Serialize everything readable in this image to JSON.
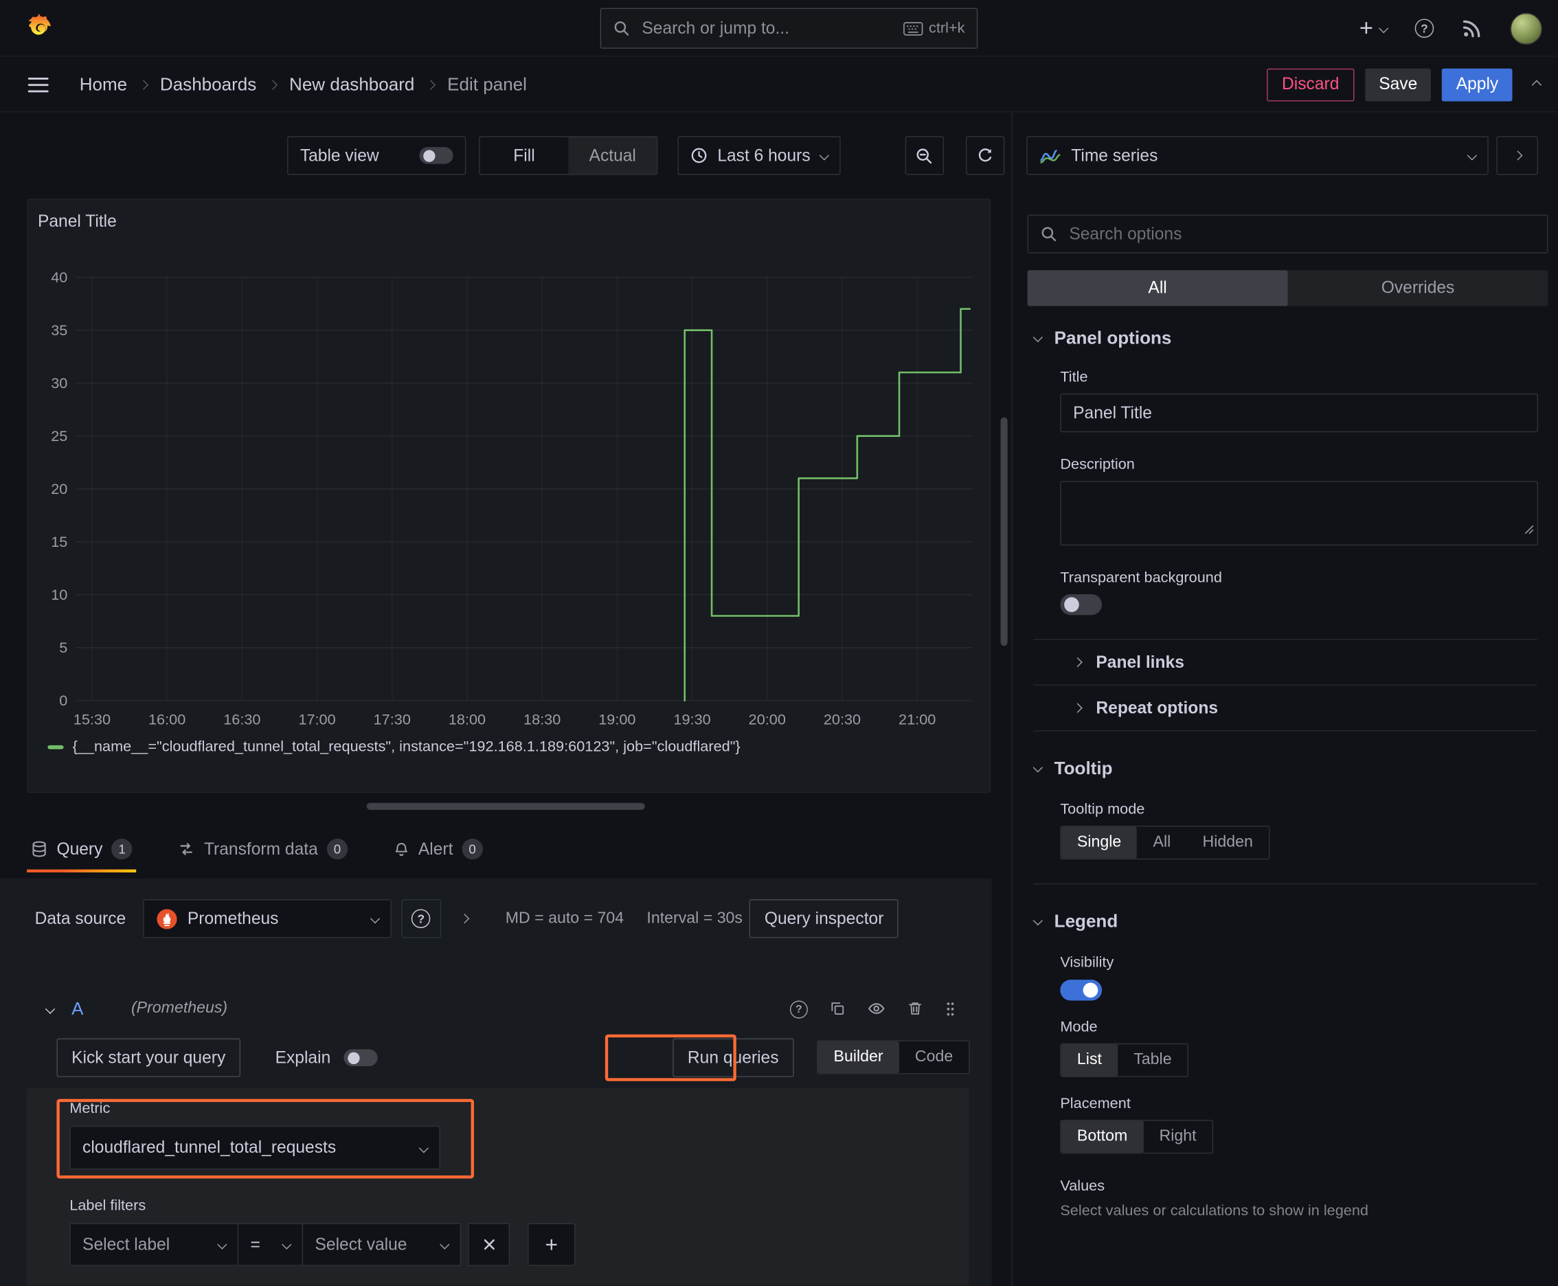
{
  "topbar": {
    "search_placeholder": "Search or jump to...",
    "shortcut": "ctrl+k"
  },
  "breadcrumb": {
    "items": [
      "Home",
      "Dashboards",
      "New dashboard",
      "Edit panel"
    ]
  },
  "header_actions": {
    "discard": "Discard",
    "save": "Save",
    "apply": "Apply"
  },
  "panel_toolbar": {
    "table_view": "Table view",
    "fill": "Fill",
    "actual": "Actual",
    "time_range": "Last 6 hours"
  },
  "panel": {
    "title": "Panel Title"
  },
  "chart_data": {
    "type": "line",
    "title": "Panel Title",
    "x_domain": [
      15.39,
      21.37
    ],
    "y_domain": [
      0,
      40
    ],
    "x_ticks": {
      "values": [
        15.5,
        16,
        16.5,
        17,
        17.5,
        18,
        18.5,
        19,
        19.5,
        20,
        20.5,
        21
      ],
      "labels": [
        "15:30",
        "16:00",
        "16:30",
        "17:00",
        "17:30",
        "18:00",
        "18:30",
        "19:00",
        "19:30",
        "20:00",
        "20:30",
        "21:00"
      ]
    },
    "y_ticks": {
      "values": [
        0,
        5,
        10,
        15,
        20,
        25,
        30,
        35,
        40
      ],
      "labels": [
        "0",
        "5",
        "10",
        "15",
        "20",
        "25",
        "30",
        "35",
        "40"
      ]
    },
    "grid": true,
    "legend_position": "bottom",
    "series": [
      {
        "name": "{__name__=\"cloudflared_tunnel_total_requests\", instance=\"192.168.1.189:60123\", job=\"cloudflared\"}",
        "color": "#73BF69",
        "points": [
          [
            19.45,
            0
          ],
          [
            19.45,
            35
          ],
          [
            19.63,
            35
          ],
          [
            19.63,
            8
          ],
          [
            20.21,
            8
          ],
          [
            20.21,
            21
          ],
          [
            20.6,
            21
          ],
          [
            20.6,
            25
          ],
          [
            20.88,
            25
          ],
          [
            20.88,
            31
          ],
          [
            21.29,
            31
          ],
          [
            21.29,
            37
          ],
          [
            21.35,
            37
          ]
        ]
      }
    ]
  },
  "query_tabs": [
    {
      "label": "Query",
      "badge": "1"
    },
    {
      "label": "Transform data",
      "badge": "0"
    },
    {
      "label": "Alert",
      "badge": "0"
    }
  ],
  "query_editor": {
    "data_source_label": "Data source",
    "data_source_value": "Prometheus",
    "max_data_points": "MD = auto = 704",
    "interval": "Interval = 30s",
    "query_inspector": "Query inspector",
    "ref_id": "A",
    "ref_note": "(Prometheus)",
    "kick_start": "Kick start your query",
    "explain": "Explain",
    "run_queries": "Run queries",
    "builder": "Builder",
    "code": "Code",
    "metric_label": "Metric",
    "metric_value": "cloudflared_tunnel_total_requests",
    "label_filters": "Label filters",
    "select_label": "Select label",
    "operator": "=",
    "select_value": "Select value"
  },
  "sidebar": {
    "visualization": "Time series",
    "search_placeholder": "Search options",
    "tab_all": "All",
    "tab_overrides": "Overrides",
    "panel_options": {
      "header": "Panel options",
      "title_label": "Title",
      "title_value": "Panel Title",
      "description_label": "Description",
      "transparent_background": "Transparent background",
      "panel_links": "Panel links",
      "repeat_options": "Repeat options"
    },
    "tooltip": {
      "header": "Tooltip",
      "mode_label": "Tooltip mode",
      "options": [
        "Single",
        "All",
        "Hidden"
      ]
    },
    "legend": {
      "header": "Legend",
      "visibility": "Visibility",
      "mode_label": "Mode",
      "mode_options": [
        "List",
        "Table"
      ],
      "placement_label": "Placement",
      "placement_options": [
        "Bottom",
        "Right"
      ],
      "values_label": "Values",
      "values_help": "Select values or calculations to show in legend"
    }
  },
  "annotations": {
    "highlight_color": "#FF6B35"
  },
  "colors": {
    "accent_blue": "#3D71D9",
    "brand_orange": "#FF780A",
    "series_green": "#73BF69",
    "danger_pink": "#FF5286",
    "prometheus_orange": "#E6522C"
  }
}
